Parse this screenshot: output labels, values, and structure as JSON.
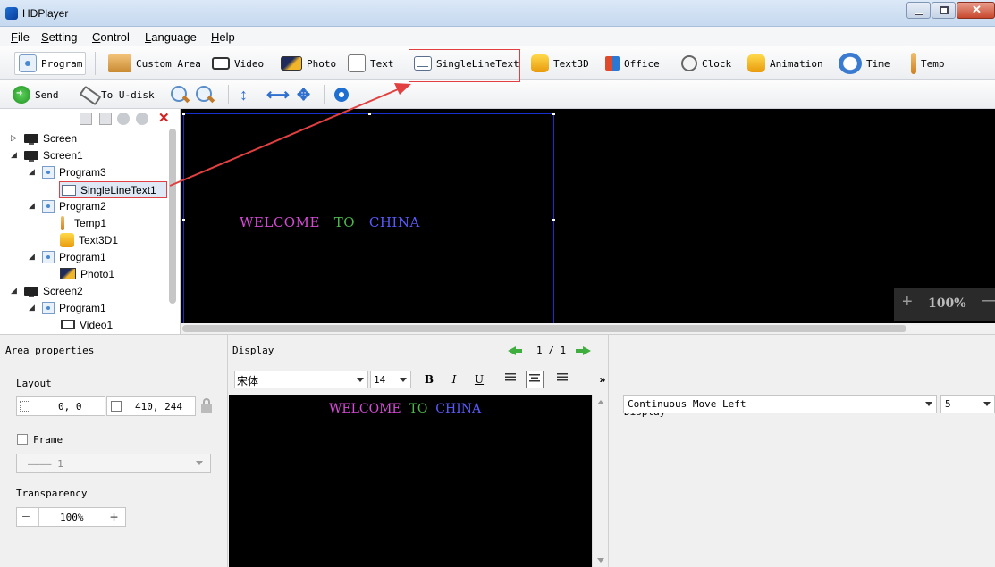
{
  "window": {
    "title": "HDPlayer"
  },
  "menu": [
    "File",
    "Setting",
    "Control",
    "Language",
    "Help"
  ],
  "toolbar1": {
    "program": "Program",
    "custom_area": "Custom Area",
    "video": "Video",
    "photo": "Photo",
    "text": "Text",
    "single_line_text": "SingleLineText",
    "text3d": "Text3D",
    "office": "Office",
    "clock": "Clock",
    "animation": "Animation",
    "time": "Time",
    "temp": "Temp"
  },
  "toolbar2": {
    "send": "Send",
    "to_udisk": "To U-disk"
  },
  "tree": {
    "items": [
      {
        "label": "Screen",
        "arrow": "▷"
      },
      {
        "label": "Screen1",
        "arrow": "◢"
      },
      {
        "label": "Program3",
        "arrow": "◢"
      },
      {
        "label": "SingleLineText1"
      },
      {
        "label": "Program2",
        "arrow": "◢"
      },
      {
        "label": "Temp1"
      },
      {
        "label": "Text3D1"
      },
      {
        "label": "Program1",
        "arrow": "◢"
      },
      {
        "label": "Photo1"
      },
      {
        "label": "Screen2",
        "arrow": "◢"
      },
      {
        "label": "Program1",
        "arrow": "◢"
      },
      {
        "label": "Video1"
      }
    ]
  },
  "canvas": {
    "words": [
      {
        "text": "WELCOME",
        "color": "#d84ad8"
      },
      {
        "text": "TO",
        "color": "#4cb84c"
      },
      {
        "text": "CHINA",
        "color": "#5a5aff"
      }
    ],
    "zoom": {
      "plus": "+",
      "value": "100%",
      "minus": "—"
    }
  },
  "area_properties": {
    "title": "Area properties",
    "layout_label": "Layout",
    "position": "0, 0",
    "size": "410, 244",
    "frame_label": "Frame",
    "frame_value": "———— 1",
    "transparency_label": "Transparency",
    "transparency_value": "100%",
    "minus": "—",
    "plus": "+"
  },
  "display_panel": {
    "title": "Display",
    "page": "1 / 1",
    "font": "宋体",
    "font_size": "14",
    "bold": "B",
    "italic": "I",
    "underline": "U",
    "more": "»",
    "editor_words": [
      {
        "text": "WELCOME",
        "color": "#d84ad8"
      },
      {
        "text": "TO",
        "color": "#4cb84c"
      },
      {
        "text": "CHINA",
        "color": "#5a5aff"
      }
    ]
  },
  "right_panel": {
    "display_label": "Display",
    "effect": "Continuous Move Left",
    "speed": "5"
  },
  "colors": {
    "highlight_red": "#e24040",
    "canvas_bg": "#000000"
  }
}
